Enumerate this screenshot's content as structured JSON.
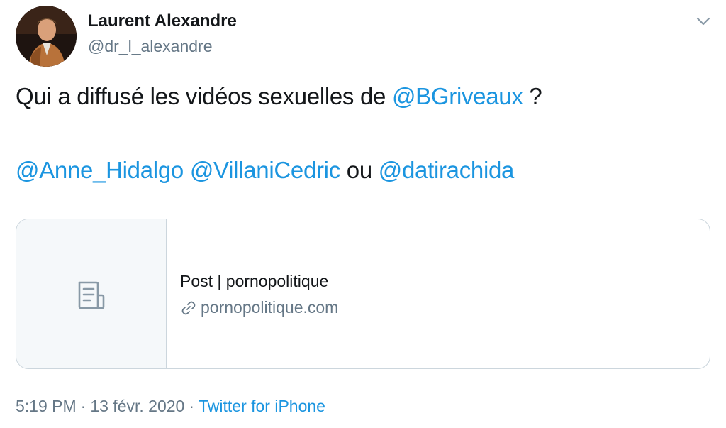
{
  "author": {
    "name": "Laurent Alexandre",
    "handle": "@dr_l_alexandre"
  },
  "tweet": {
    "line1_text": "Qui a diffusé les vidéos sexuelles de ",
    "line1_mention": "@BGriveaux",
    "line1_suffix": " ?",
    "mention_1": "@Anne_Hidalgo",
    "mention_2": "@VillaniCedric",
    "connector": " ou ",
    "mention_3": "@datirachida"
  },
  "card": {
    "thumbnail_icon": "document-icon",
    "title": "Post | pornopolitique",
    "domain_icon": "link-icon",
    "domain": "pornopolitique.com"
  },
  "meta": {
    "time": "5:19 PM",
    "date": "13 févr. 2020",
    "separator": "·",
    "source": "Twitter for iPhone"
  },
  "colors": {
    "link": "#1b95e0",
    "secondary_text": "#657786",
    "border": "#ccd6dd",
    "primary_text": "#14171a"
  },
  "icons": {
    "caret": "chevron-down-icon"
  }
}
